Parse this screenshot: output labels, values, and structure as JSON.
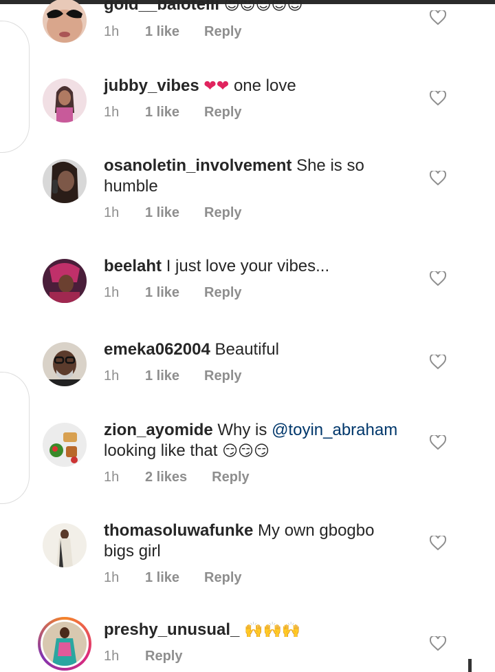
{
  "comments": [
    {
      "user": "gold__balotelli",
      "text": "",
      "emoji": "😍😍😍😍😍",
      "time": "1h",
      "likes": "1 like",
      "reply": "Reply",
      "avatar": "avatar-face-glasses"
    },
    {
      "user": "jubby_vibes",
      "text": "one love",
      "emoji_pre": "❤❤",
      "time": "1h",
      "likes": "1 like",
      "reply": "Reply",
      "avatar": "avatar-woman-pink"
    },
    {
      "user": "osanoletin_involvement",
      "text": "She is so humble",
      "time": "1h",
      "likes": "1 like",
      "reply": "Reply",
      "avatar": "avatar-woman-phone"
    },
    {
      "user": "beelaht",
      "text": "I just love your vibes...",
      "time": "1h",
      "likes": "1 like",
      "reply": "Reply",
      "avatar": "avatar-woman-red"
    },
    {
      "user": "emeka062004",
      "text": "Beautiful",
      "time": "1h",
      "likes": "1 like",
      "reply": "Reply",
      "avatar": "avatar-man-glasses"
    },
    {
      "user": "zion_ayomide",
      "text_pre": "Why is",
      "mention": "@toyin_abraham",
      "text_post": "looking like that",
      "emoji": "😏😏😏",
      "time": "1h",
      "likes": "2 likes",
      "reply": "Reply",
      "avatar": "avatar-food"
    },
    {
      "user": "thomasoluwafunke",
      "text": "My own gbogbo bigs girl",
      "time": "1h",
      "likes": "1 like",
      "reply": "Reply",
      "avatar": "avatar-person-standing"
    },
    {
      "user": "preshy_unusual_",
      "emoji": "🙌🙌🙌",
      "time": "1h",
      "reply": "Reply",
      "avatar": "avatar-woman-blue-story"
    }
  ],
  "icons": {
    "like": "heart-outline-icon"
  },
  "colors": {
    "text": "#262626",
    "meta": "#8e8e8e",
    "mention": "#00376b"
  }
}
